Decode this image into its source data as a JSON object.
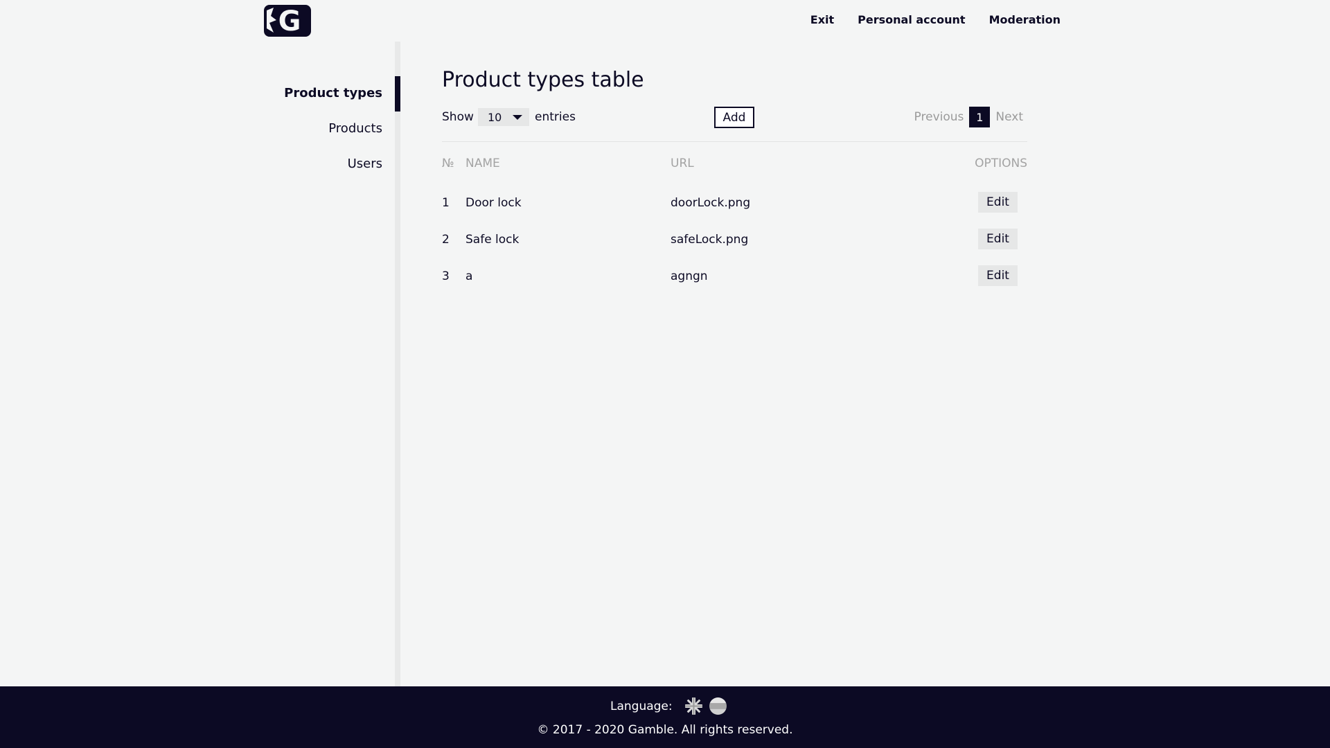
{
  "header": {
    "logo_text": "G",
    "nav": [
      "Exit",
      "Personal account",
      "Moderation"
    ]
  },
  "sidebar": {
    "items": [
      {
        "label": "Product types",
        "active": true
      },
      {
        "label": "Products",
        "active": false
      },
      {
        "label": "Users",
        "active": false
      }
    ]
  },
  "main": {
    "title": "Product types table",
    "show_label": "Show",
    "page_size": "10",
    "entries_label": "entries",
    "add_label": "Add",
    "pagination": {
      "previous": "Previous",
      "current": "1",
      "next": "Next"
    },
    "table": {
      "columns": [
        "№",
        "NAME",
        "URL",
        "OPTIONS"
      ],
      "rows": [
        {
          "num": "1",
          "name": "Door lock",
          "url": "doorLock.png",
          "action": "Edit"
        },
        {
          "num": "2",
          "name": "Safe lock",
          "url": "safeLock.png",
          "action": "Edit"
        },
        {
          "num": "3",
          "name": "a",
          "url": "agngn",
          "action": "Edit"
        }
      ]
    }
  },
  "footer": {
    "language_label": "Language:",
    "flags": [
      "uk-flag-icon",
      "ru-flag-icon"
    ],
    "copyright": "© 2017 - 2020 Gamble. All rights reserved."
  },
  "colors": {
    "primary": "#0c0a24",
    "background": "#f4f5f5",
    "muted": "#a3a3a3"
  }
}
